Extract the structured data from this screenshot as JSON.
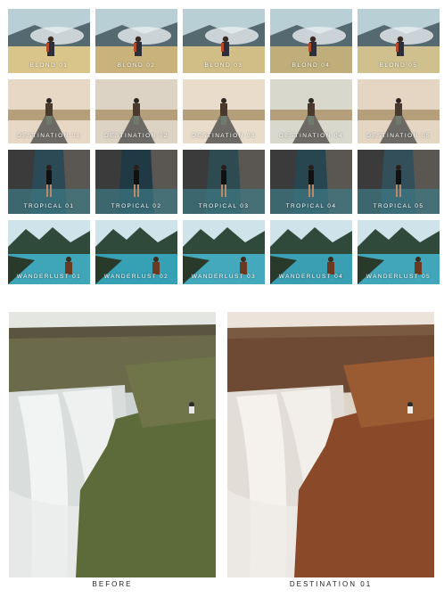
{
  "rows": [
    {
      "theme": "mountain",
      "tiles": [
        {
          "label": "BLOND 01",
          "tint": "#d9c58a"
        },
        {
          "label": "BLOND 02",
          "tint": "#c9b37a"
        },
        {
          "label": "BLOND 03",
          "tint": "#d1bd86"
        },
        {
          "label": "BLOND 04",
          "tint": "#bfae7a"
        },
        {
          "label": "BLOND 05",
          "tint": "#cfc08e"
        }
      ]
    },
    {
      "theme": "road",
      "tiles": [
        {
          "label": "DESTINATION 01",
          "tint": "#e7d7c5"
        },
        {
          "label": "DESTINATION 02",
          "tint": "#ddd3c4"
        },
        {
          "label": "DESTINATION 03",
          "tint": "#e9dccb"
        },
        {
          "label": "DESTINATION 04",
          "tint": "#d9d8cd"
        },
        {
          "label": "DESTINATION 05",
          "tint": "#e4d6c3"
        }
      ]
    },
    {
      "theme": "beach",
      "tiles": [
        {
          "label": "TROPICAL 01",
          "tint": "#2b4a55"
        },
        {
          "label": "TROPICAL 02",
          "tint": "#1f3a44"
        },
        {
          "label": "TROPICAL 03",
          "tint": "#2f4b52"
        },
        {
          "label": "TROPICAL 04",
          "tint": "#284650"
        },
        {
          "label": "TROPICAL 05",
          "tint": "#33505a"
        }
      ]
    },
    {
      "theme": "fjord",
      "tiles": [
        {
          "label": "WANDERLUST 01",
          "tint": "#3fa5b8"
        },
        {
          "label": "WANDERLUST 02",
          "tint": "#36a0b4"
        },
        {
          "label": "WANDERLUST 03",
          "tint": "#44a9bc"
        },
        {
          "label": "WANDERLUST 04",
          "tint": "#3a9fb2"
        },
        {
          "label": "WANDERLUST 05",
          "tint": "#41a6b9"
        }
      ]
    }
  ],
  "comparison": {
    "before_label": "BEFORE",
    "after_label": "DESTINATION 01",
    "before_rock": "#5d6a3a",
    "after_rock": "#8a4a2a"
  }
}
